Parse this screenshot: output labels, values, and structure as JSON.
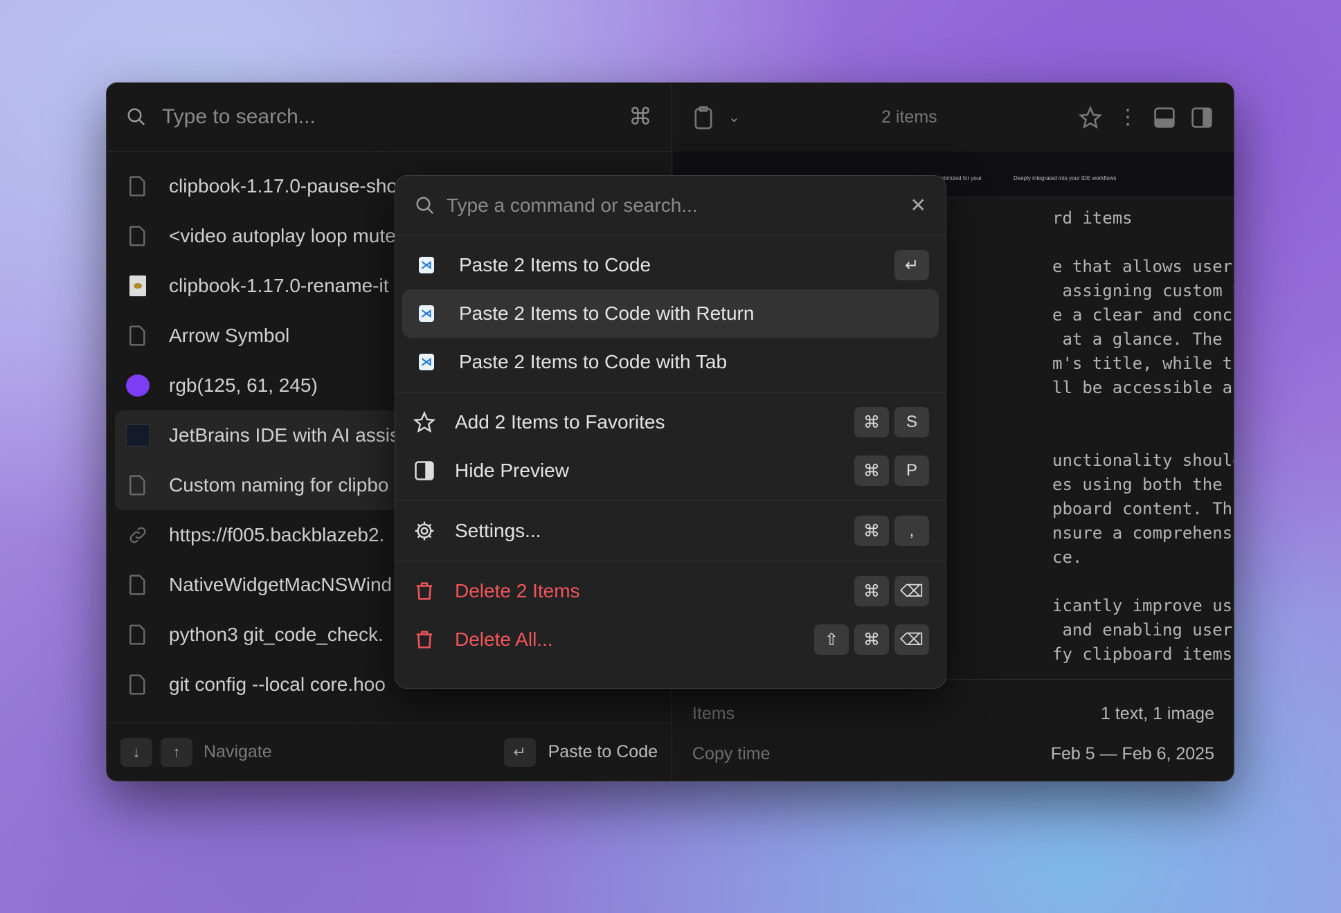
{
  "left": {
    "search_placeholder": "Type to search...",
    "items": [
      {
        "label": "clipbook-1.17.0-pause-sho",
        "icon": "document-icon"
      },
      {
        "label": "<video autoplay loop mute",
        "icon": "document-icon"
      },
      {
        "label": "clipbook-1.17.0-rename-it",
        "icon": "video-file-icon"
      },
      {
        "label": "Arrow Symbol",
        "icon": "document-icon"
      },
      {
        "label": "rgb(125, 61, 245)",
        "icon": "color-swatch",
        "color": "#7d3df5"
      },
      {
        "label": "JetBrains IDE with AI assis",
        "icon": "image-thumbnail",
        "selected": true
      },
      {
        "label": "Custom naming for clipbo",
        "icon": "document-icon",
        "selected": true
      },
      {
        "label": "https://f005.backblazeb2.",
        "icon": "link-icon"
      },
      {
        "label": "NativeWidgetMacNSWind",
        "icon": "document-icon"
      },
      {
        "label": "python3 git_code_check.",
        "icon": "document-icon"
      },
      {
        "label": "git config --local core.hoo",
        "icon": "document-icon"
      }
    ],
    "footer": {
      "navigate": "Navigate",
      "paste": "Paste to Code"
    }
  },
  "right": {
    "count": "2 items",
    "preview_lines": [
      "rd items",
      "",
      "e that allows users to",
      " assigning custom titles.",
      "e a clear and concise way",
      " at a glance. The custom",
      "m's title, while the full",
      "ll be accessible as it is",
      "",
      "",
      "unctionality should be",
      "es using both the custom",
      "pboard content. This dual-",
      "nsure a comprehensive and",
      "ce.",
      "",
      "icantly improve usability",
      " and enabling users to",
      "fy clipboard items."
    ],
    "strip_text": [
      "dge LLMs optimized for your",
      "Deeply integrated into your IDE workflows"
    ],
    "meta": [
      {
        "key": "Items",
        "value": "1 text, 1 image"
      },
      {
        "key": "Copy time",
        "value": "Feb 5 — Feb 6, 2025"
      }
    ]
  },
  "palette": {
    "placeholder": "Type a command or search...",
    "sections": [
      [
        {
          "label": "Paste 2 Items to Code",
          "icon": "vscode-icon",
          "keys": [
            "↵"
          ]
        },
        {
          "label": "Paste 2 Items to Code with Return",
          "icon": "vscode-icon",
          "keys": [],
          "highlighted": true
        },
        {
          "label": "Paste 2 Items to Code with Tab",
          "icon": "vscode-icon",
          "keys": []
        }
      ],
      [
        {
          "label": "Add 2 Items to Favorites",
          "icon": "star-icon",
          "keys": [
            "⌘",
            "S"
          ]
        },
        {
          "label": "Hide Preview",
          "icon": "sidebar-icon",
          "keys": [
            "⌘",
            "P"
          ]
        }
      ],
      [
        {
          "label": "Settings...",
          "icon": "gear-icon",
          "keys": [
            "⌘",
            ","
          ]
        }
      ],
      [
        {
          "label": "Delete 2 Items",
          "icon": "trash-icon",
          "keys": [
            "⌘",
            "⌫"
          ],
          "danger": true
        },
        {
          "label": "Delete All...",
          "icon": "trash-icon",
          "keys": [
            "⇧",
            "⌘",
            "⌫"
          ],
          "danger": true
        }
      ]
    ]
  },
  "colors": {
    "danger": "#f0555a",
    "swatch": "#7d3df5",
    "accent": "#1f7ad0"
  }
}
